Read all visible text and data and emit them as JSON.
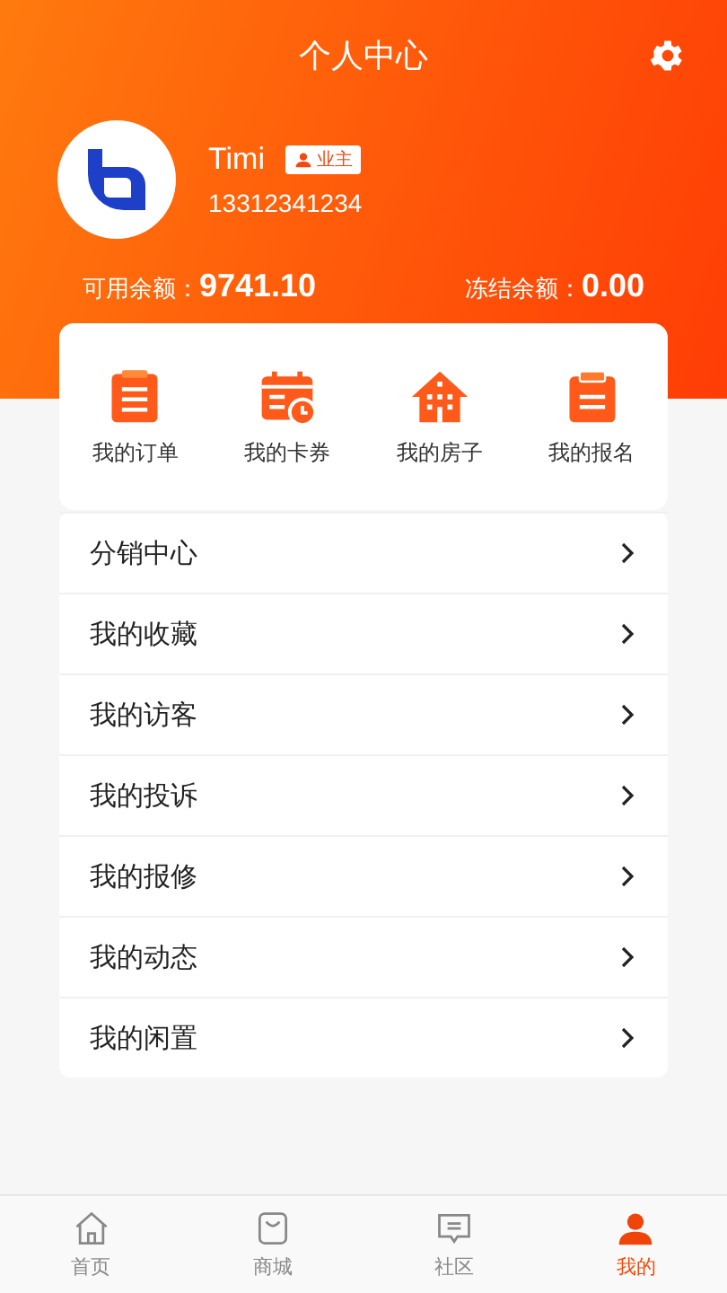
{
  "header": {
    "title": "个人中心"
  },
  "profile": {
    "name": "Timi",
    "badge": "业主",
    "phone": "13312341234"
  },
  "balances": [
    {
      "label": "可用余额：",
      "value": "9741.10"
    },
    {
      "label": "冻结余额：",
      "value": "0.00"
    }
  ],
  "shortcuts": [
    {
      "kind": "list",
      "label": "我的订单"
    },
    {
      "kind": "calendar",
      "label": "我的卡券"
    },
    {
      "kind": "house",
      "label": "我的房子"
    },
    {
      "kind": "clipboard",
      "label": "我的报名"
    }
  ],
  "menu": [
    {
      "label": "分销中心"
    },
    {
      "label": "我的收藏"
    },
    {
      "label": "我的访客"
    },
    {
      "label": "我的投诉"
    },
    {
      "label": "我的报修"
    },
    {
      "label": "我的动态"
    },
    {
      "label": "我的闲置"
    }
  ],
  "tabs": [
    {
      "kind": "home",
      "label": "首页",
      "selected": false
    },
    {
      "kind": "bag",
      "label": "商城",
      "selected": false
    },
    {
      "kind": "chat",
      "label": "社区",
      "selected": false
    },
    {
      "kind": "person",
      "label": "我的",
      "selected": true
    }
  ]
}
